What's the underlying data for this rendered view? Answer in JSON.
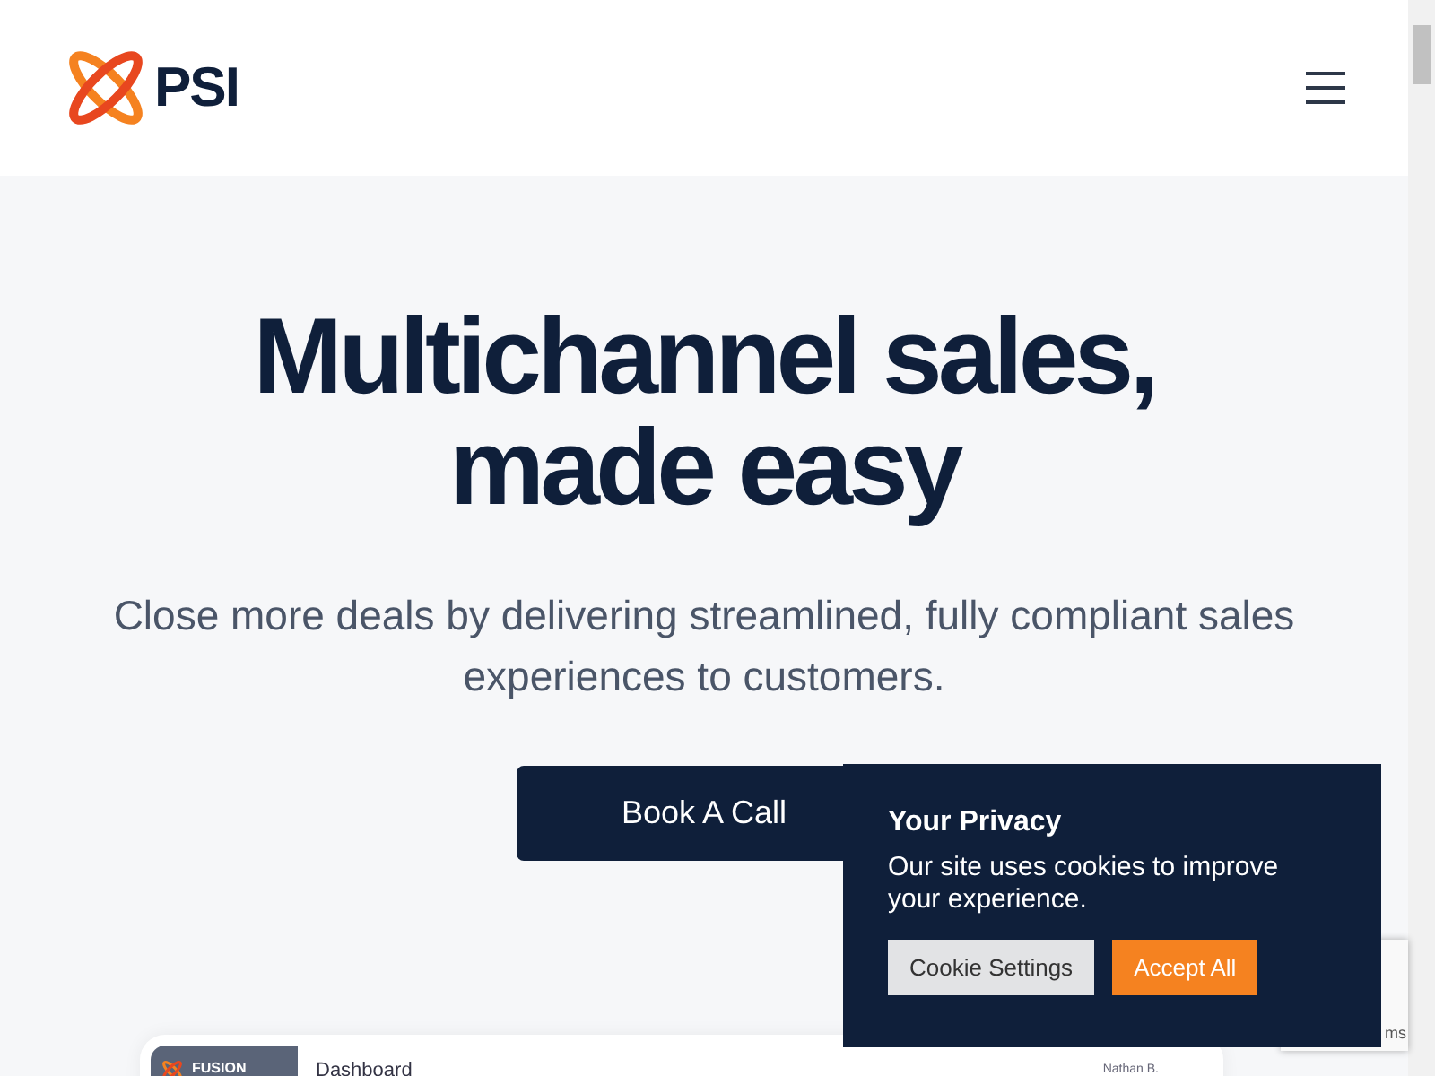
{
  "header": {
    "logo_text": "PSI"
  },
  "hero": {
    "title_lines": [
      "Multichannel sales,",
      "made easy"
    ],
    "subtitle": "Close more deals by delivering streamlined, fully compliant sales experiences to customers.",
    "button": "Book A Call"
  },
  "preview": {
    "brand": "FUSION",
    "page": "Dashboard",
    "user": "Nathan B."
  },
  "recaptcha": {
    "text": "ms"
  },
  "cookie_banner": {
    "title": "Your Privacy",
    "message": "Our site uses cookies to improve your experience.",
    "buttons": [
      {
        "label": "Cookie Settings",
        "kind": "secondary"
      },
      {
        "label": "Accept All",
        "kind": "primary"
      }
    ]
  }
}
